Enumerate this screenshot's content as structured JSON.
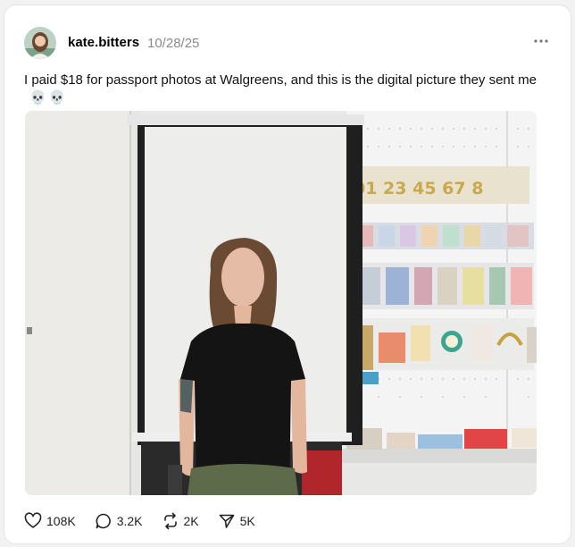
{
  "post": {
    "author": "kate.bitters",
    "date": "10/28/25",
    "caption": "I paid $18 for passport photos at Walgreens, and this is the digital picture they sent me",
    "caption_emoji": "💀💀",
    "more_menu": "more-options-icon"
  },
  "media": {
    "shelf_digits": "01 23 45 67 8"
  },
  "actions": {
    "likes": "108K",
    "replies": "3.2K",
    "reposts": "2K",
    "shares": "5K"
  },
  "icons": {
    "like": "heart-icon",
    "reply": "speech-bubble-icon",
    "repost": "repost-arrows-icon",
    "share": "send-icon"
  },
  "colors": {
    "background": "#f2f2f2",
    "card": "#ffffff",
    "text": "#000000",
    "muted": "#8a8a8a"
  }
}
